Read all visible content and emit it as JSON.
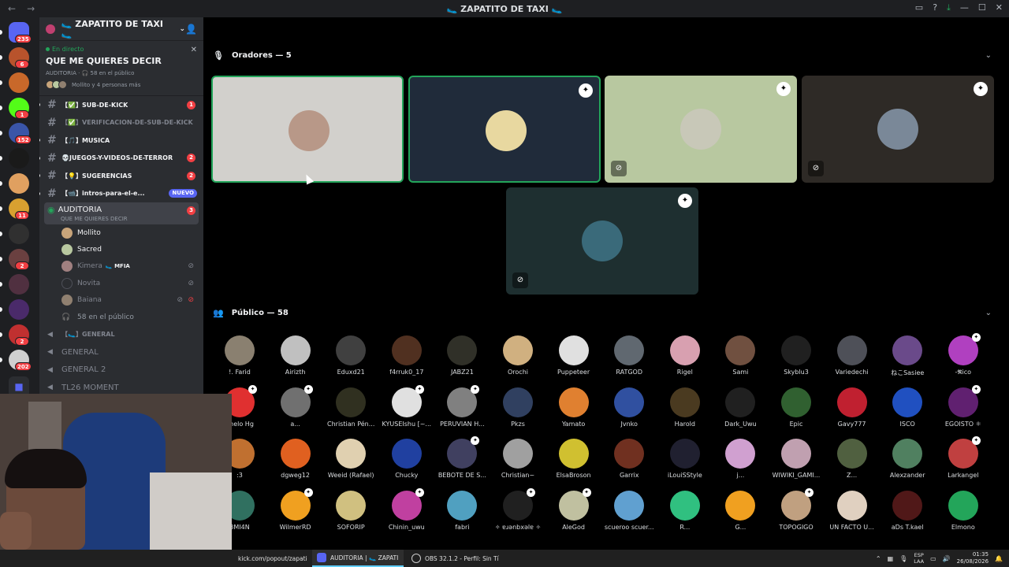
{
  "window": {
    "title": "🥿 ZAPATITO DE TAXI 🥿",
    "back_label": "←",
    "forward_label": "→"
  },
  "server_rail": [
    {
      "badge": "235",
      "color": "#5865f2"
    },
    {
      "badge": "6",
      "color": "#b8532c"
    },
    {
      "badge": "",
      "color": "#c8682a"
    },
    {
      "badge": "1",
      "color": "#53fc18"
    },
    {
      "badge": "152",
      "color": "#3a55a8"
    },
    {
      "badge": "",
      "color": "#1a1a1a"
    },
    {
      "badge": "",
      "color": "#e0a060"
    },
    {
      "badge": "11",
      "color": "#d8a030"
    },
    {
      "badge": "",
      "color": "#303030"
    },
    {
      "badge": "2",
      "color": "#6a4040"
    },
    {
      "badge": "",
      "color": "#503040"
    },
    {
      "badge": "",
      "color": "#4a2a6a"
    },
    {
      "badge": "2",
      "color": "#c03030"
    },
    {
      "badge": "202",
      "color": "#d0d0d0"
    }
  ],
  "sidebar": {
    "server_name": "🥿 ZAPATITO DE TAXI 🥿",
    "live": {
      "status": "En directo",
      "title": "QUE ME QUIERES DECIR",
      "sub": "AUDITORIA · 🎧 58 en el público",
      "people": "Mollito y 4 personas más"
    },
    "channels": [
      {
        "name": "【✅】SUB-DE-KICK",
        "badge": "1",
        "muted": false
      },
      {
        "name": "【✅】VERIFICACION-DE-SUB-DE-KICK",
        "badge": "",
        "muted": true
      },
      {
        "name": "【🎵】MUSICA",
        "badge": "",
        "muted": false
      },
      {
        "name": "💀JUEGOS-Y-VIDEOS-DE-TERROR",
        "badge": "2",
        "muted": false
      },
      {
        "name": "【💡】SUGERENCIAS",
        "badge": "2",
        "muted": false
      },
      {
        "name": "【📹】intros-para-el-e...",
        "badge": "",
        "new": "NUEVO",
        "muted": false
      }
    ],
    "active_stage": {
      "name": "AUDITORIA",
      "topic": "QUE ME QUIERES DECIR",
      "badge": "3"
    },
    "members": [
      {
        "name": "Mollito",
        "muted": false,
        "tag": "",
        "color": "#c8a47a"
      },
      {
        "name": "Sacred",
        "muted": false,
        "tag": "",
        "color": "#b8c8a0"
      },
      {
        "name": "Kimera",
        "muted": true,
        "tag": "🥿 MFIA",
        "color": "#a08080"
      },
      {
        "name": "Novita",
        "muted": true,
        "tag": "",
        "color": "#2b2d31"
      },
      {
        "name": "Baiana",
        "muted": true,
        "tag": "",
        "color": "#908070"
      }
    ],
    "audience_count": "58 en el público",
    "voice_channels": [
      {
        "name": "【🥿】GENERAL",
        "small": true
      },
      {
        "name": "GENERAL",
        "small": false
      },
      {
        "name": "GENERAL 2",
        "small": false
      },
      {
        "name": "TL26 MOMENT",
        "small": false
      }
    ]
  },
  "main": {
    "speakers_header": "Oradores — 5",
    "speakers": [
      {
        "bg": "#d2d0cc",
        "avatar": "#b89888",
        "corner": false,
        "mute": false,
        "border": "#23a55a"
      },
      {
        "bg": "#202b3a",
        "avatar": "#e8d8a0",
        "corner": true,
        "mute": false,
        "border": "#23a55a"
      },
      {
        "bg": "#b8c8a0",
        "avatar": "#c8c8b8",
        "corner": true,
        "mute": true,
        "border": ""
      },
      {
        "bg": "#2e2a26",
        "avatar": "#7a8898",
        "corner": true,
        "mute": true,
        "border": ""
      },
      {
        "bg": "#1e2f30",
        "avatar": "#3a6a7a",
        "corner": true,
        "mute": true,
        "border": ""
      }
    ],
    "audience_header": "Público — 58",
    "audience": [
      {
        "name": "!. Farid",
        "color": "#8a8070"
      },
      {
        "name": "Airizth",
        "color": "#c0c0c0"
      },
      {
        "name": "Eduxd21",
        "color": "#404040"
      },
      {
        "name": "f4rruk0_17",
        "color": "#503020"
      },
      {
        "name": "JABZ21",
        "color": "#303028"
      },
      {
        "name": "Orochi",
        "color": "#d0b080"
      },
      {
        "name": "Puppeteer",
        "color": "#e0e0e0"
      },
      {
        "name": "RATGOD",
        "color": "#606870"
      },
      {
        "name": "Rigel",
        "color": "#d8a0b0"
      },
      {
        "name": "Sami",
        "color": "#705040"
      },
      {
        "name": "Skyblu3",
        "color": "#202020"
      },
      {
        "name": "Variedechi",
        "color": "#4e5058"
      },
      {
        "name": "ねこSasiee",
        "color": "#6a4a8a"
      },
      {
        "name": "-𝕽ico",
        "color": "#b040c0",
        "mark": true
      },
      {
        "name": "ghelo Hg",
        "color": "#e03030",
        "mark": true
      },
      {
        "name": "a...",
        "color": "#707070",
        "mark": true
      },
      {
        "name": "Christian Pén...",
        "color": "#303020"
      },
      {
        "name": "KYUSEIshu [~...",
        "color": "#e0e0e0",
        "mark": true
      },
      {
        "name": "PERUVIAN H...",
        "color": "#808080",
        "mark": true
      },
      {
        "name": "Pkzs",
        "color": "#304060"
      },
      {
        "name": "Yamato",
        "color": "#e08030"
      },
      {
        "name": "Jvnko",
        "color": "#3050a0"
      },
      {
        "name": "Harold",
        "color": "#4a3a20"
      },
      {
        "name": "Dark_Uwu",
        "color": "#202020"
      },
      {
        "name": "Epic",
        "color": "#306030"
      },
      {
        "name": "Gavy777",
        "color": "#c02030"
      },
      {
        "name": "ISCO",
        "color": "#2050c0"
      },
      {
        "name": "EGOISTO ⚛",
        "color": "#602070",
        "mark": true
      },
      {
        "name": ":3",
        "color": "#c07030"
      },
      {
        "name": "dgweg12",
        "color": "#e06020"
      },
      {
        "name": "Weeid (Rafael)",
        "color": "#e0d0b0"
      },
      {
        "name": "Chucky",
        "color": "#2040a0"
      },
      {
        "name": "BEBOTE DE S...",
        "color": "#404060",
        "mark": true
      },
      {
        "name": "Christian~",
        "color": "#a0a0a0"
      },
      {
        "name": "ElsaBroson",
        "color": "#d0c030"
      },
      {
        "name": "Garrix",
        "color": "#703020"
      },
      {
        "name": "iLouiSStyle",
        "color": "#202030"
      },
      {
        "name": "j...",
        "color": "#d0a0d0"
      },
      {
        "name": "WIWIKI_GAMI...",
        "color": "#c0a0b0"
      },
      {
        "name": "Z...",
        "color": "#506040"
      },
      {
        "name": "Alexzander",
        "color": "#508060"
      },
      {
        "name": "Larkangel",
        "color": "#c04040",
        "mark": true
      },
      {
        "name": "3MI4N",
        "color": "#307060"
      },
      {
        "name": "WilmerRD",
        "color": "#f0a020",
        "mark": true
      },
      {
        "name": "SOFORIP",
        "color": "#d0c080"
      },
      {
        "name": "Chinin_uwu",
        "color": "#c040a0",
        "mark": true
      },
      {
        "name": "fabri",
        "color": "#50a0c0"
      },
      {
        "name": "✧ ɐɹǝnbxǝlɐ ✧",
        "color": "#202020",
        "mark": true
      },
      {
        "name": "AleGod",
        "color": "#c0c0a0",
        "mark": true
      },
      {
        "name": "scueroo scuer...",
        "color": "#60a0d0"
      },
      {
        "name": "R...",
        "color": "#30c080"
      },
      {
        "name": "G...",
        "color": "#f0a020"
      },
      {
        "name": "TOPOGIGO",
        "color": "#c0a080",
        "mark": true
      },
      {
        "name": "UN FACTO U...",
        "color": "#e0d0c0"
      },
      {
        "name": "aDs T.kael",
        "color": "#501818"
      },
      {
        "name": "Elmono",
        "color": "#23a55a"
      }
    ]
  },
  "taskbar": {
    "items": [
      {
        "label": "kick.com/popout/zapati",
        "active": false
      },
      {
        "label": "AUDITORIA | 🥿 ZAPATI",
        "active": true
      },
      {
        "label": "OBS 32.1.2 - Perfil: Sin Tí",
        "active": false
      }
    ],
    "lang_top": "ESP",
    "lang_bottom": "LAA",
    "time": "01:35",
    "date": "26/08/2026"
  }
}
